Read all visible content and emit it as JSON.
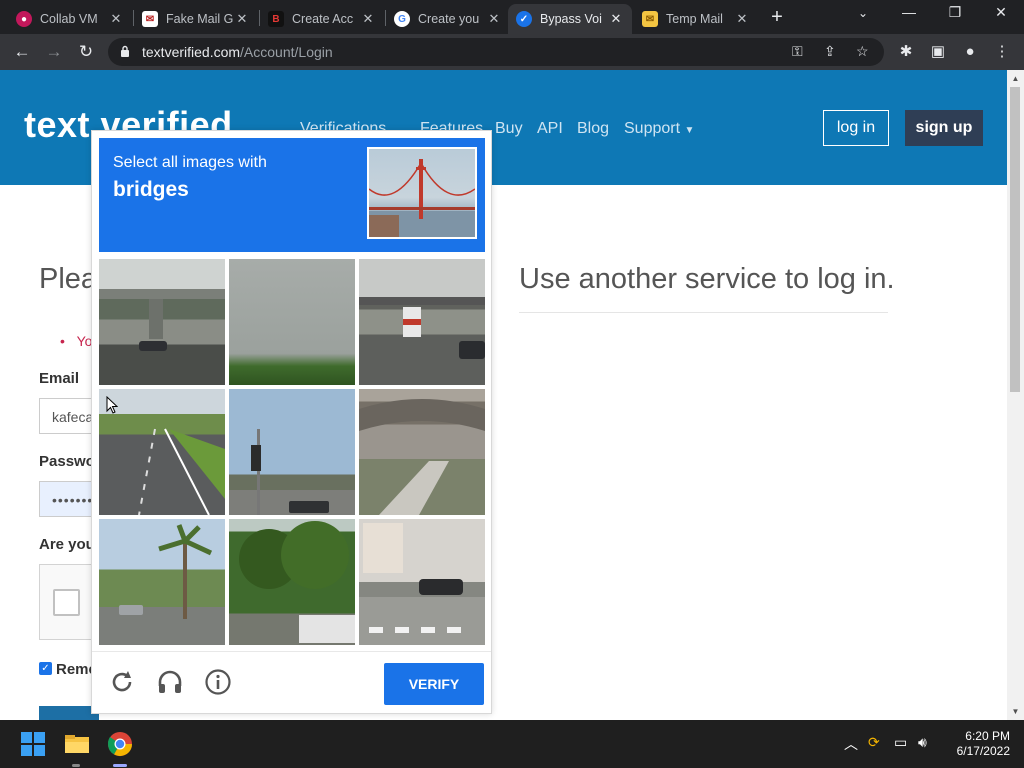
{
  "browser": {
    "tabs": [
      {
        "label": "Collab VM",
        "icon": "collab-icon",
        "color": "#c2185b"
      },
      {
        "label": "Fake Mail G",
        "icon": "mail-icon",
        "color": "#b71c1c"
      },
      {
        "label": "Create Acc",
        "icon": "b-logo-icon",
        "color": "#d32f2f"
      },
      {
        "label": "Create you",
        "icon": "google-icon",
        "color": "#ffffff"
      },
      {
        "label": "Bypass Voi",
        "icon": "check-icon",
        "color": "#1a73e8"
      },
      {
        "label": "Temp Mail",
        "icon": "envelope-icon",
        "color": "#f4c542"
      }
    ],
    "active_tab_index": 4,
    "url_host": "textverified.com",
    "url_path": "/Account/Login"
  },
  "site": {
    "logo_text": "text",
    "logo_text_2": "verified",
    "nav": {
      "verifications": "Verifications",
      "features": "Features",
      "buy": "Buy",
      "api": "API",
      "blog": "Blog",
      "support": "Support"
    },
    "login_button": "log in",
    "signup_button": "sign up"
  },
  "login_form": {
    "heading": "Plea",
    "error_text": "Yo",
    "email_label": "Email",
    "email_value": "kafeca",
    "password_label": "Passwo",
    "password_value": "••••••••",
    "human_label": "Are you",
    "remember_label": "Remem",
    "remember_checked": true
  },
  "external_login": {
    "heading": "Use another service to log in."
  },
  "captcha": {
    "prompt": "Select all images with",
    "target": "bridges",
    "tiles": [
      {
        "index": 1,
        "desc": "highway overpass"
      },
      {
        "index": 2,
        "desc": "cloudy sky treeline"
      },
      {
        "index": 3,
        "desc": "highway overpass with truck"
      },
      {
        "index": 4,
        "desc": "highway road"
      },
      {
        "index": 5,
        "desc": "intersection with traffic light"
      },
      {
        "index": 6,
        "desc": "curved overpass"
      },
      {
        "index": 7,
        "desc": "palm trees street"
      },
      {
        "index": 8,
        "desc": "trees and truck"
      },
      {
        "index": 9,
        "desc": "crosswalk and car"
      }
    ],
    "verify_label": "VERIFY",
    "accent": "#1a73e8"
  },
  "taskbar": {
    "time": "6:20 PM",
    "date": "6/17/2022"
  }
}
